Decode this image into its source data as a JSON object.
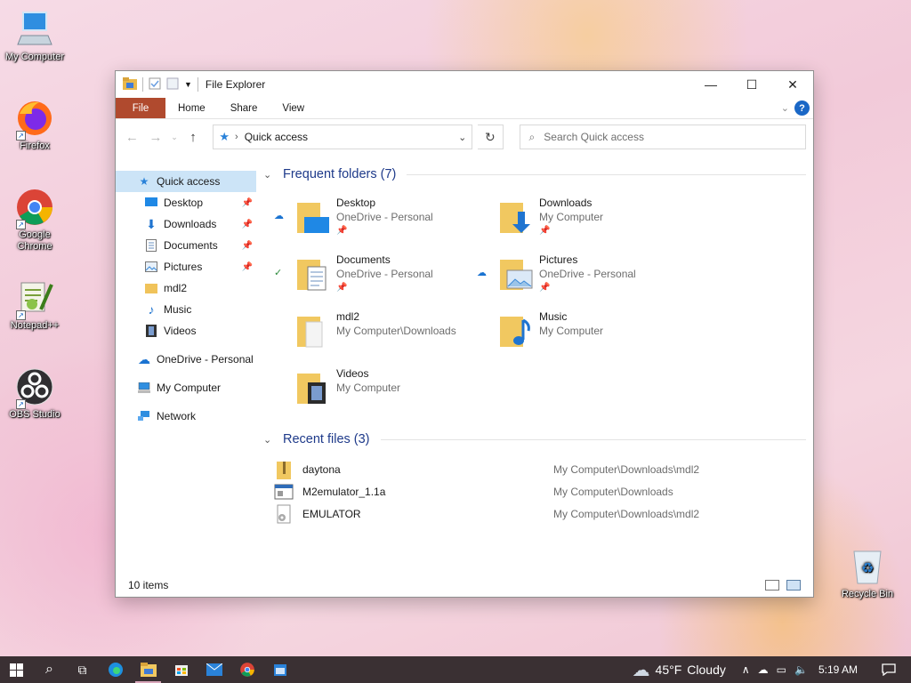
{
  "desktop": {
    "icons": [
      {
        "label": "My Computer"
      },
      {
        "label": "Firefox"
      },
      {
        "label": "Google Chrome"
      },
      {
        "label": "Notepad++"
      },
      {
        "label": "OBS Studio"
      },
      {
        "label": "Recycle Bin"
      }
    ]
  },
  "window": {
    "title": "File Explorer",
    "ribbon": {
      "file": "File",
      "tabs": [
        "Home",
        "Share",
        "View"
      ]
    },
    "address": {
      "location": "Quick access",
      "search_placeholder": "Search Quick access"
    },
    "nav": [
      {
        "label": "Quick access"
      },
      {
        "label": "Desktop"
      },
      {
        "label": "Downloads"
      },
      {
        "label": "Documents"
      },
      {
        "label": "Pictures"
      },
      {
        "label": "mdl2"
      },
      {
        "label": "Music"
      },
      {
        "label": "Videos"
      },
      {
        "label": "OneDrive - Personal"
      },
      {
        "label": "My Computer"
      },
      {
        "label": "Network"
      }
    ],
    "frequent": {
      "heading": "Frequent folders (7)",
      "items": [
        {
          "name": "Desktop",
          "location": "OneDrive - Personal"
        },
        {
          "name": "Downloads",
          "location": "My Computer"
        },
        {
          "name": "Documents",
          "location": "OneDrive - Personal"
        },
        {
          "name": "Pictures",
          "location": "OneDrive - Personal"
        },
        {
          "name": "mdl2",
          "location": "My Computer\\Downloads"
        },
        {
          "name": "Music",
          "location": "My Computer"
        },
        {
          "name": "Videos",
          "location": "My Computer"
        }
      ]
    },
    "recent": {
      "heading": "Recent files (3)",
      "items": [
        {
          "name": "daytona",
          "path": "My Computer\\Downloads\\mdl2"
        },
        {
          "name": "M2emulator_1.1a",
          "path": "My Computer\\Downloads"
        },
        {
          "name": "EMULATOR",
          "path": "My Computer\\Downloads\\mdl2"
        }
      ]
    },
    "status": {
      "count": "10 items"
    }
  },
  "taskbar": {
    "weather": {
      "temp": "45°F",
      "condition": "Cloudy"
    },
    "time": "5:19 AM"
  },
  "colors": {
    "accent": "#1a67c6",
    "file_tab": "#b04a2e",
    "selection": "#cce4f7",
    "heading": "#1e3a8a"
  }
}
